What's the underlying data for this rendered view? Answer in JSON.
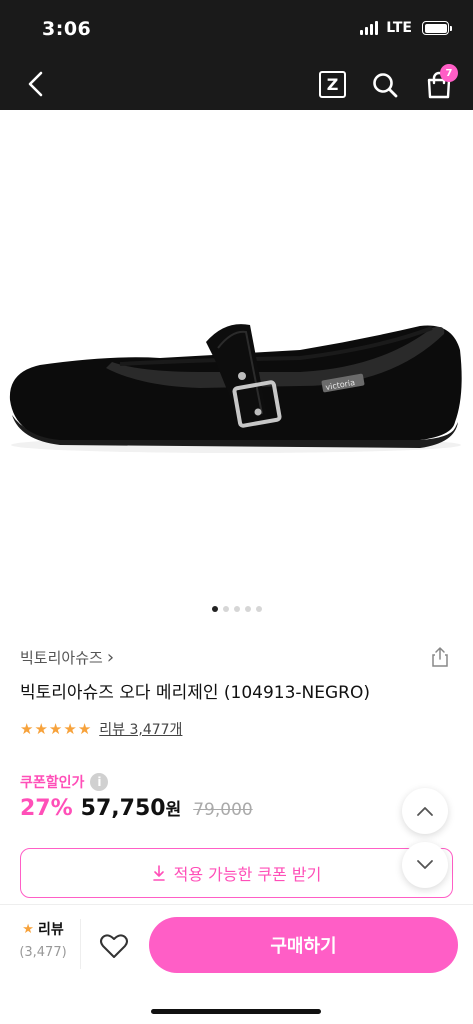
{
  "status": {
    "time": "3:06",
    "network": "LTE",
    "signal_bars": 4,
    "battery_level": 1.0
  },
  "nav": {
    "z_label": "Z",
    "cart_count": "7"
  },
  "gallery": {
    "image_count": 5,
    "active_index": 0,
    "shoe_brand_label": "victoria"
  },
  "product": {
    "brand": "빅토리아슈즈",
    "brand_chevron": "›",
    "title": "빅토리아슈즈 오다 메리제인 (104913-NEGRO)",
    "rating": 5,
    "review_text": "리뷰 3,477개",
    "coupon_label": "쿠폰할인가",
    "info_icon": "i",
    "discount": "27%",
    "price": "57,750",
    "price_unit": "원",
    "original_price": "79,000"
  },
  "coupon_button": {
    "label": "적용 가능한 쿠폰 받기",
    "icon": "download-icon"
  },
  "bottom_bar": {
    "review_label": "리뷰",
    "review_count": "(3,477)",
    "buy_label": "구매하기"
  },
  "colors": {
    "accent": "#ff5ec6",
    "star": "#f7a23b",
    "header": "#1a1a1a"
  }
}
